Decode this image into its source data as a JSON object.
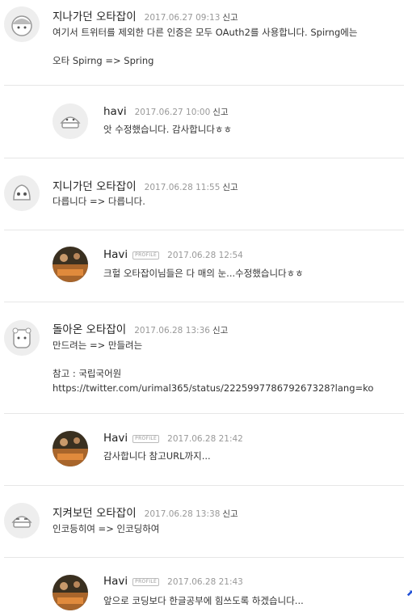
{
  "comments": [
    {
      "author": "지나가던 오타잡이",
      "date": "2017.06.27 09:13",
      "report": "신고",
      "lines": [
        "여기서 트위터를 제외한 다른 인증은 모두 OAuth2를 사용합니다. Spirng에는",
        "",
        "오타 Spirng => Spring"
      ]
    },
    {
      "author": "havi",
      "date": "2017.06.27 10:00",
      "report": "신고",
      "lines": [
        "앗 수정했습니다. 감사합니다ㅎㅎ"
      ]
    },
    {
      "author": "지니가던 오타잡이",
      "date": "2017.06.28 11:55",
      "report": "신고",
      "lines": [
        "다릅니다 => 다릅니다."
      ]
    },
    {
      "author": "Havi",
      "badge": "PROFILE",
      "date": "2017.06.28 12:54",
      "lines": [
        "크헐 오타잡이님들은 다 매의 눈...수정했습니다ㅎㅎ"
      ]
    },
    {
      "author": "돌아온 오타잡이",
      "date": "2017.06.28 13:36",
      "report": "신고",
      "lines": [
        "만드려는 => 만들려는",
        "",
        "참고 : 국립국어원",
        "https://twitter.com/urimal365/status/222599778679267328?lang=ko"
      ]
    },
    {
      "author": "Havi",
      "badge": "PROFILE",
      "date": "2017.06.28 21:42",
      "lines": [
        "감사합니다 참고URL까지..."
      ]
    },
    {
      "author": "지켜보던 오타잡이",
      "date": "2017.06.28 13:38",
      "report": "신고",
      "lines": [
        "인코등히여 => 인코딩하여"
      ]
    },
    {
      "author": "Havi",
      "badge": "PROFILE",
      "date": "2017.06.28 21:43",
      "lines": [
        "앞으로 코딩보다 한글공부에 힘쓰도록 하겠습니다..."
      ]
    }
  ]
}
